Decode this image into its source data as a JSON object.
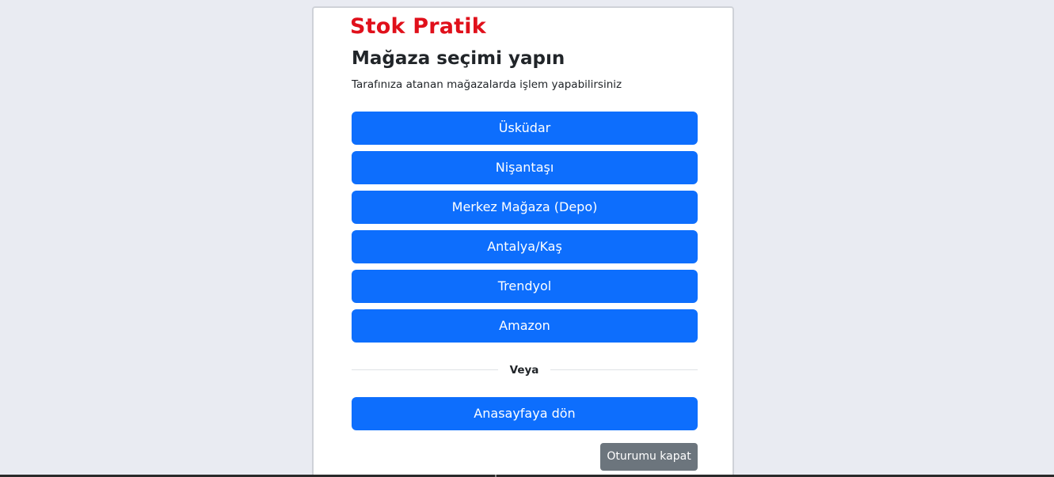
{
  "brand": {
    "name": "Stok Pratik",
    "color": "#e0101b"
  },
  "header": {
    "title": "Mağaza seçimi yapın",
    "subtitle": "Tarafınıza atanan mağazalarda işlem yapabilirsiniz"
  },
  "stores": [
    {
      "label": "Üsküdar"
    },
    {
      "label": "Nişantaşı"
    },
    {
      "label": "Merkez Mağaza (Depo)"
    },
    {
      "label": "Antalya/Kaş"
    },
    {
      "label": "Trendyol"
    },
    {
      "label": "Amazon"
    }
  ],
  "divider": {
    "label": "Veya"
  },
  "actions": {
    "home_label": "Anasayfaya dön",
    "logout_label": "Oturumu kapat"
  },
  "colors": {
    "primary": "#0d6efd",
    "secondary": "#6c757d",
    "background": "#e9ebf2"
  }
}
